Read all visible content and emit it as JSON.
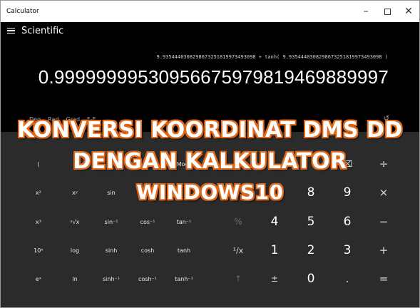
{
  "window": {
    "title": "Calculator",
    "minimize": "–",
    "close": "✕"
  },
  "header": {
    "mode": "Scientific"
  },
  "display": {
    "expression": "9.93544403082986732518199734930​98 + tanh( 9.9354440308298673251819973493098 )",
    "result": "0.99999999530956675979819469889997"
  },
  "mode_row": {
    "items": [
      "Deg",
      "Rad",
      "Grad",
      "F-E"
    ]
  },
  "overlay": {
    "line1": "KONVERSI KOORDINAT DMS DD",
    "line2": "DENGAN KALKULATOR",
    "line3": "WINDOWS10"
  },
  "keys": {
    "r1": [
      "(",
      "Mod",
      "⌫",
      "÷"
    ],
    "r2": [
      "x²",
      "xʸ",
      "sin",
      "8",
      "9",
      "×"
    ],
    "r3": [
      "x³",
      "ʸ√x",
      "sin⁻¹",
      "cos⁻¹",
      "tan⁻¹",
      "%",
      "4",
      "5",
      "6",
      "−"
    ],
    "r4": [
      "10ˣ",
      "log",
      "sinh",
      "cosh",
      "tanh",
      "¹/x",
      "1",
      "2",
      "3",
      "+"
    ],
    "r5": [
      "eˣ",
      "ln",
      "sinh⁻¹",
      "cosh⁻¹",
      "tanh⁻¹",
      "↑",
      "±",
      "0",
      ".",
      "="
    ]
  }
}
